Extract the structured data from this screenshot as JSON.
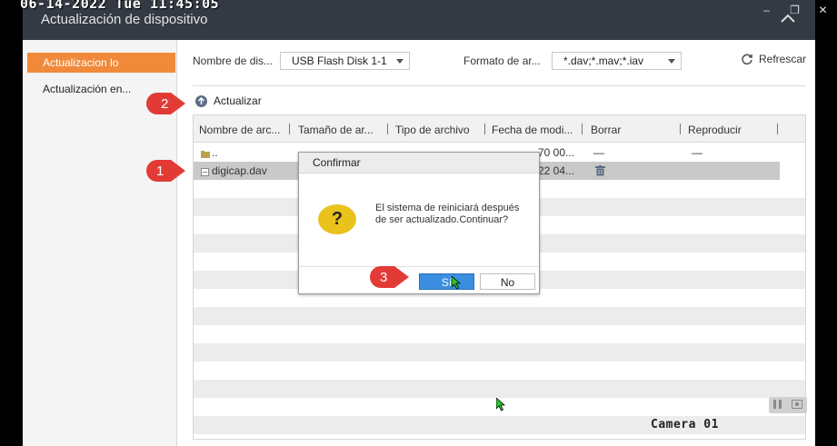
{
  "osd": {
    "timestamp": "06-14-2022 Tue 11:45:05",
    "camera_label": "Camera 01"
  },
  "window": {
    "title": "Actualización de dispositivo",
    "controls": {
      "minimize": "–",
      "restore": "❐",
      "close": "✕"
    }
  },
  "sidebar": {
    "items": [
      {
        "label": "Actualizacion lo",
        "active": true
      },
      {
        "label": "Actualización en...",
        "active": false
      }
    ]
  },
  "toolbar": {
    "device_label": "Nombre de dis...",
    "device_value": "USB Flash Disk 1-1",
    "format_label": "Formato de ar...",
    "format_value": "*.dav;*.mav;*.iav",
    "refresh_label": "Refrescar",
    "upgrade_label": "Actualizar"
  },
  "table": {
    "columns": [
      "Nombre de arc...",
      "Tamaño de ar...",
      "Tipo de archivo",
      "Fecha de modi...",
      "Borrar",
      "Reproducir"
    ],
    "rows": [
      {
        "name": "..",
        "date": "70 00...",
        "delete": "—",
        "play": "—"
      },
      {
        "name": "digicap.dav",
        "date": "22 04...",
        "delete": "trash-icon"
      }
    ]
  },
  "dialog": {
    "title": "Confirmar",
    "message": "El sistema de reiniciará después de ser actualizado.Continuar?",
    "yes_label": "Sí",
    "no_label": "No"
  },
  "annotations": [
    {
      "label": "1"
    },
    {
      "label": "2"
    },
    {
      "label": "3"
    }
  ],
  "colors": {
    "accent_orange": "#f08a3a",
    "titlebar": "#333a43",
    "primary_button": "#3a8fe0",
    "callout_red": "#e23b36",
    "question_yellow": "#e9c21c"
  }
}
